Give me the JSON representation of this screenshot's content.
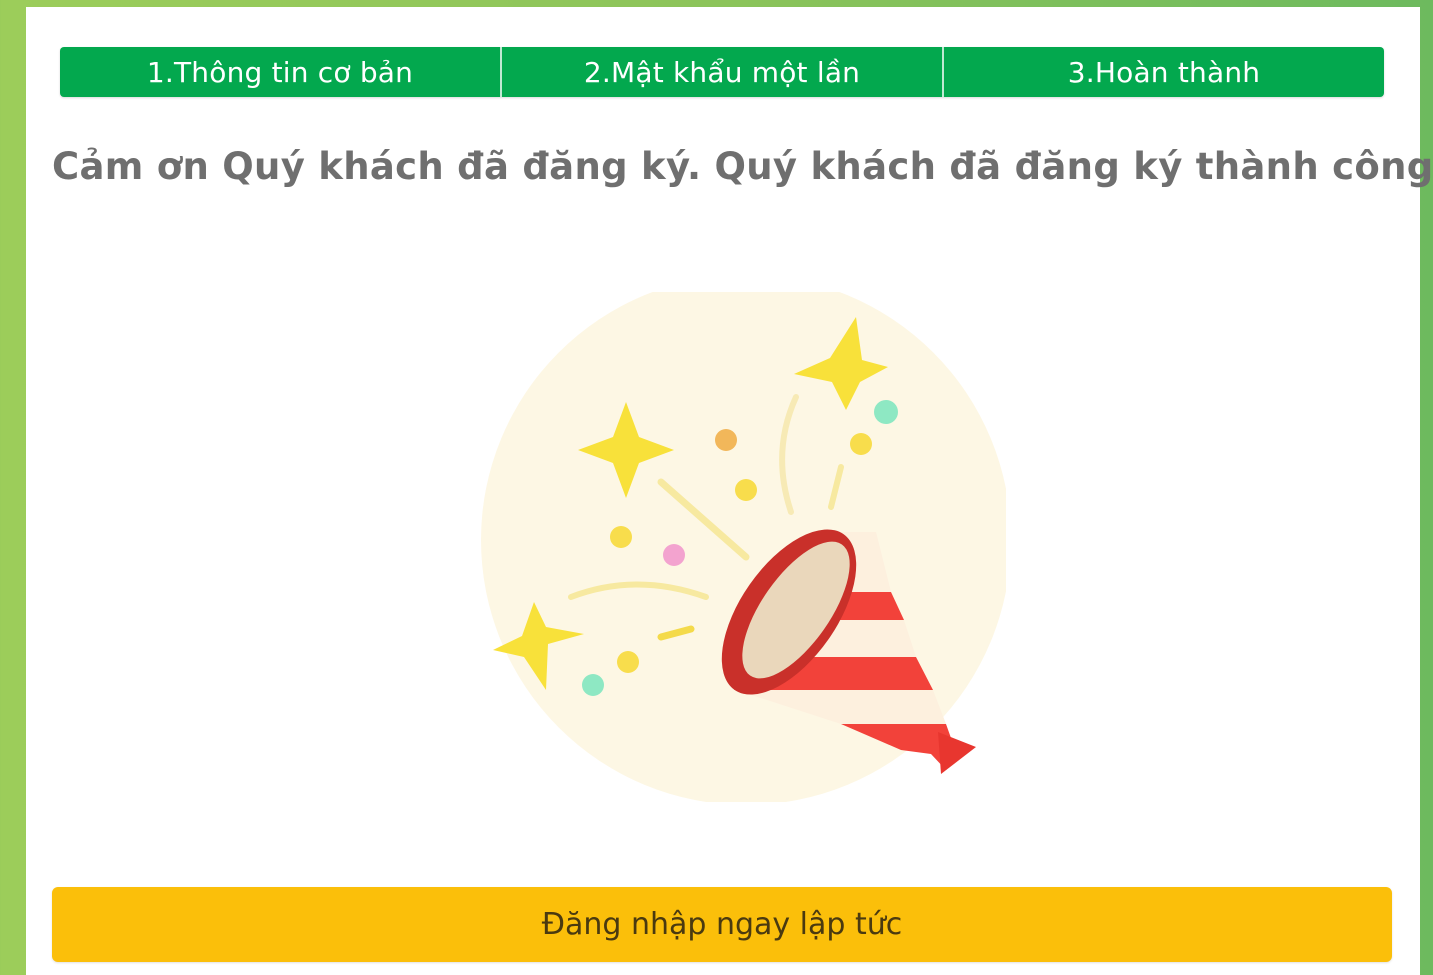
{
  "steps": [
    {
      "label": "1.Thông tin cơ bản"
    },
    {
      "label": "2.Mật khẩu một lần"
    },
    {
      "label": "3.Hoàn thành"
    }
  ],
  "message": "Cảm ơn Quý khách đã đăng ký. Quý khách đã đăng ký thành công.",
  "illustration": {
    "icon": "party-popper-icon"
  },
  "login_button": {
    "label": "Đăng nhập ngay lập tức"
  },
  "colors": {
    "steps_bg": "#03a84e",
    "button_bg": "#fbbf0a",
    "background": "#8cc45a"
  }
}
